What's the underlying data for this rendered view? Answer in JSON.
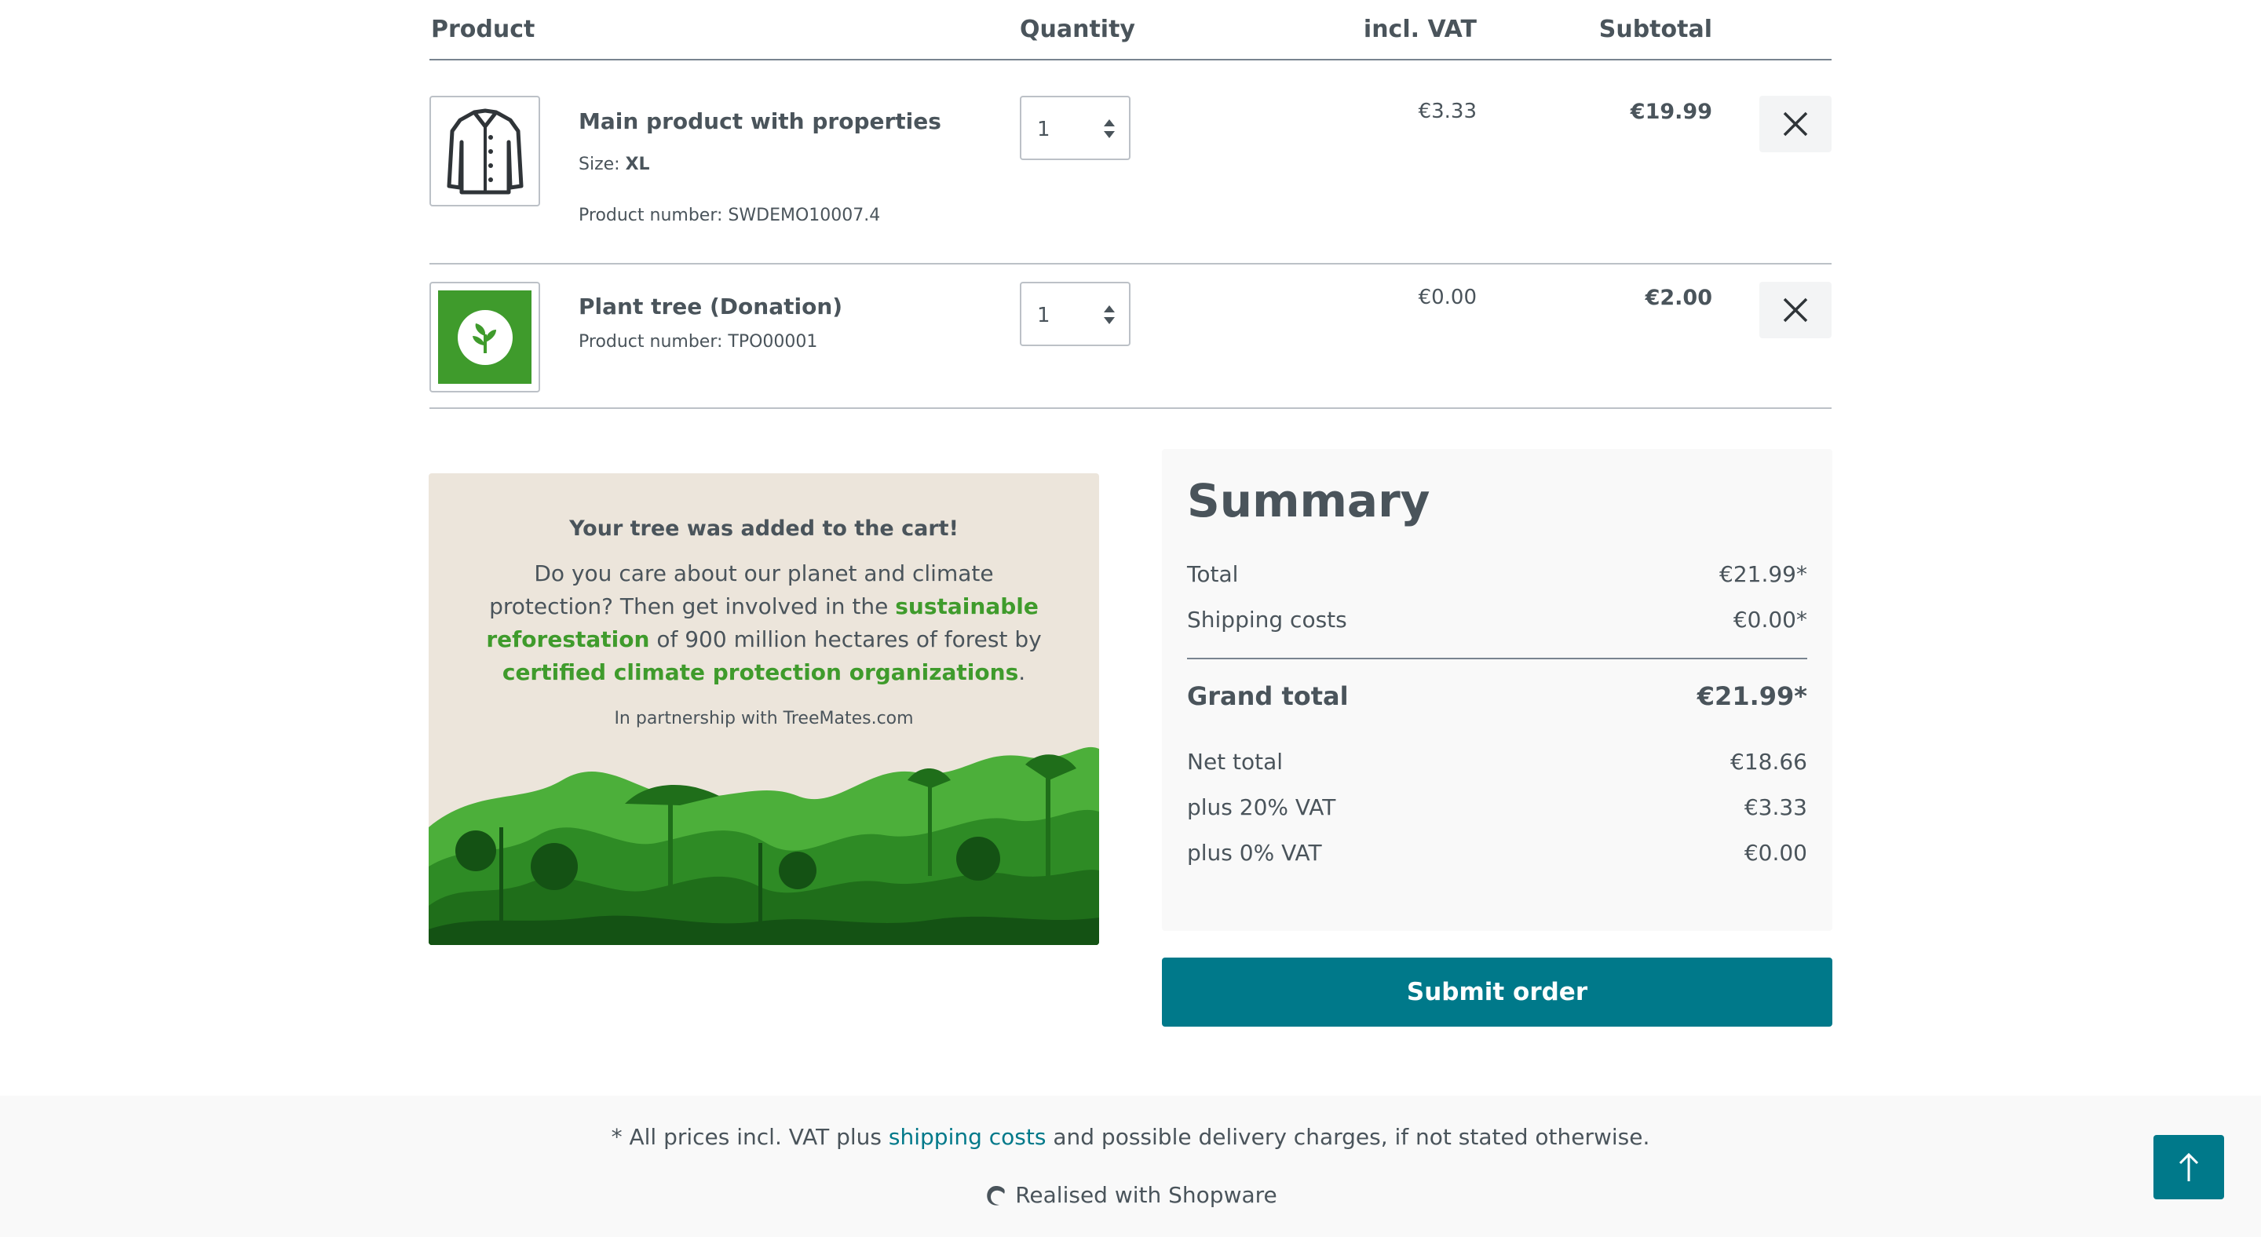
{
  "table": {
    "headers": {
      "product": "Product",
      "quantity": "Quantity",
      "incl_vat": "incl. VAT",
      "subtotal": "Subtotal"
    },
    "items": [
      {
        "name": "Main product with properties",
        "size_label": "Size:",
        "size_value": "XL",
        "product_number": "Product number: SWDEMO10007.4",
        "quantity": "1",
        "vat": "€3.33",
        "subtotal": "€19.99",
        "icon": "jacket-icon"
      },
      {
        "name": "Plant tree (Donation)",
        "product_number": "Product number: TPO00001",
        "quantity": "1",
        "vat": "€0.00",
        "subtotal": "€2.00",
        "icon": "tree-leaf-icon"
      }
    ]
  },
  "promo": {
    "title": "Your tree was added to the cart!",
    "text_1": "Do you care about our planet and climate protection? Then get involved in the ",
    "link_1": "sustainable reforestation",
    "text_2": " of 900 million hectares of forest by ",
    "link_2": "certified climate protection organizations",
    "text_3": ".",
    "partner": "In partnership with TreeMates.com",
    "colors": {
      "background": "#ece5db",
      "accent": "#3f9b2c"
    }
  },
  "summary": {
    "title": "Summary",
    "rows": [
      {
        "label": "Total",
        "value": "€21.99*"
      },
      {
        "label": "Shipping costs",
        "value": "€0.00*"
      }
    ],
    "grand_total": {
      "label": "Grand total",
      "value": "€21.99*"
    },
    "tax_rows": [
      {
        "label": "Net total",
        "value": "€18.66"
      },
      {
        "label": "plus 20% VAT",
        "value": "€3.33"
      },
      {
        "label": "plus 0% VAT",
        "value": "€0.00"
      }
    ]
  },
  "submit": {
    "label": "Submit order",
    "color": "#00798a"
  },
  "footer": {
    "note_before": "* All prices incl. VAT plus ",
    "note_link": "shipping costs",
    "note_after": " and possible delivery charges, if not stated otherwise.",
    "brand": "Realised with Shopware"
  }
}
